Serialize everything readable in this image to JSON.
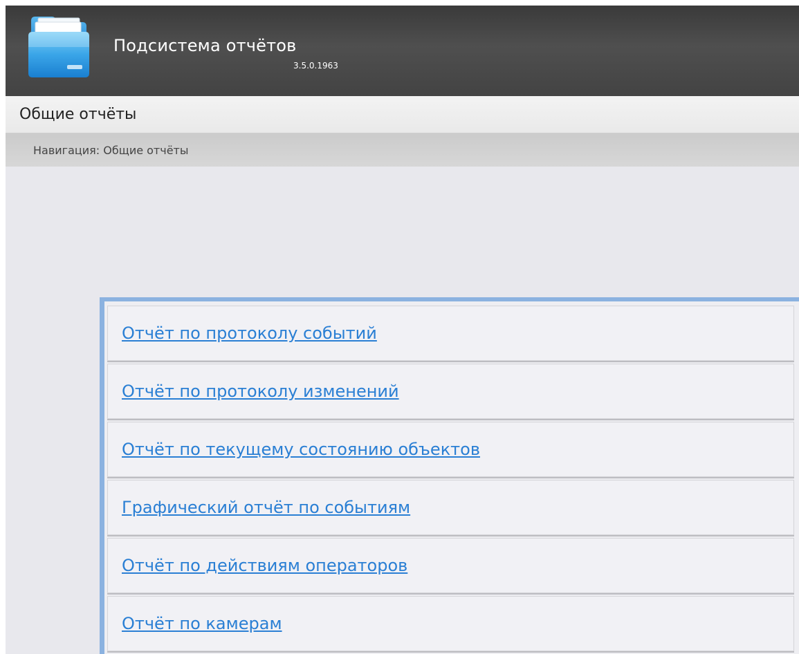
{
  "app": {
    "title": "Подсистема отчётов",
    "version": "3.5.0.1963",
    "logo_icon": "folder-icon"
  },
  "page": {
    "title": "Общие отчёты"
  },
  "breadcrumb": {
    "label": "Навигация:",
    "current": "Общие отчёты"
  },
  "colors": {
    "link": "#2a7fd4",
    "panel_accent": "#8bb2e0",
    "header_bg": "#454545"
  },
  "reports": [
    {
      "label": "Отчёт по протоколу событий"
    },
    {
      "label": "Отчёт по протоколу изменений"
    },
    {
      "label": "Отчёт по текущему состоянию объектов"
    },
    {
      "label": "Графический отчёт по событиям"
    },
    {
      "label": "Отчёт по действиям операторов"
    },
    {
      "label": "Отчёт по камерам"
    }
  ]
}
